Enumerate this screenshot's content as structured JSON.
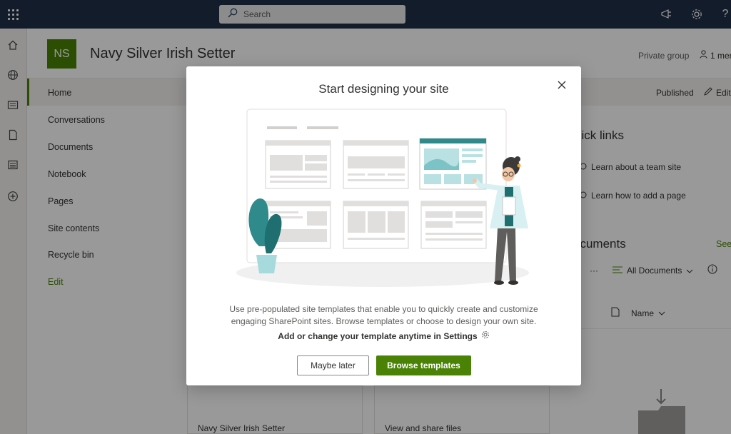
{
  "suite": {
    "search": {
      "placeholder": "Search"
    }
  },
  "site": {
    "logo_initials": "NS",
    "title": "Navy Silver Irish Setter",
    "privacy": "Private group",
    "members": "1 mer"
  },
  "nav": {
    "items": [
      {
        "label": "Home"
      },
      {
        "label": "Conversations"
      },
      {
        "label": "Documents"
      },
      {
        "label": "Notebook"
      },
      {
        "label": "Pages"
      },
      {
        "label": "Site contents"
      },
      {
        "label": "Recycle bin"
      },
      {
        "label": "Edit"
      }
    ]
  },
  "commandbar": {
    "published": "Published",
    "edit": "Edit"
  },
  "quick_links": {
    "title": "uick links",
    "items": [
      {
        "label": "Learn about a team site"
      },
      {
        "label": "Learn how to add a page"
      }
    ]
  },
  "documents": {
    "title": "ocuments",
    "see_all": "See",
    "view": "All Documents",
    "more": "···",
    "column_name": "Name"
  },
  "cards": [
    {
      "label": "Navy Silver Irish Setter"
    },
    {
      "label": "View and share files"
    }
  ],
  "modal": {
    "title": "Start designing your site",
    "description": "Use pre-populated site templates that enable you to quickly create and customize engaging SharePoint sites. Browse templates or choose to design your own site.",
    "settings_note": "Add or change your template anytime in Settings",
    "secondary_button": "Maybe later",
    "primary_button": "Browse templates"
  },
  "colors": {
    "suite_bar": "#1e3049",
    "accent": "#498205",
    "teal": "#2f8a8c"
  },
  "icons": {
    "waffle": "waffle-icon",
    "search": "search-icon",
    "megaphone": "megaphone-icon",
    "settings": "gear-icon",
    "help": "help-icon",
    "home": "home-icon",
    "globe": "globe-icon",
    "news": "news-icon",
    "file": "file-icon",
    "lists": "list-icon",
    "create": "plus-circle-icon",
    "close": "close-icon"
  }
}
